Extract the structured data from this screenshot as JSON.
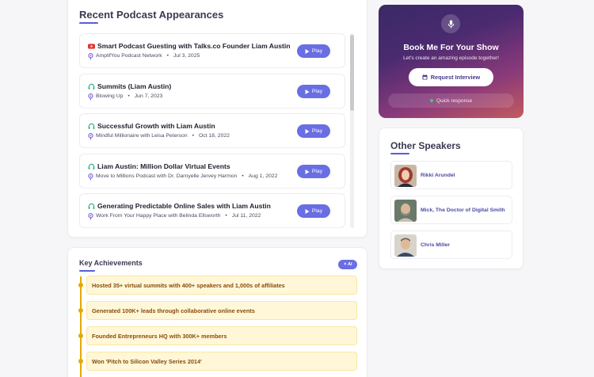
{
  "podcasts": {
    "title": "Recent Podcast Appearances",
    "play_label": "Play",
    "items": [
      {
        "title": "Smart Podcast Guesting with Talks.co Founder Liam Austin",
        "network": "AmplifYou Podcast Network",
        "date": "Jul 3, 2025",
        "icon": "youtube-icon"
      },
      {
        "title": "Summits (Liam Austin)",
        "network": "Blowing Up",
        "date": "Jun 7, 2023",
        "icon": "headphones-icon"
      },
      {
        "title": "Successful Growth with Liam Austin",
        "network": "Mindful Millionaire with Leisa Peterson",
        "date": "Oct 18, 2022",
        "icon": "headphones-icon"
      },
      {
        "title": "Liam Austin: Million Dollar Virtual Events",
        "network": "Move to Millions Podcast with Dr. Darnyelle Jervey Harmon",
        "date": "Aug 1, 2022",
        "icon": "headphones-icon"
      },
      {
        "title": "Generating Predictable Online Sales with Liam Austin",
        "network": "Work From Your Happy Place with Belinda Ellsworth",
        "date": "Jul 11, 2022",
        "icon": "headphones-icon"
      }
    ]
  },
  "achievements": {
    "title": "Key Achievements",
    "ai_badge": "AI",
    "items": [
      "Hosted 35+ virtual summits with 400+ speakers and 1,000s of affiliates",
      "Generated 100K+ leads through collaborative online events",
      "Founded Entrepreneurs HQ with 300K+ members",
      "Won 'Pitch to Silicon Valley Series 2014'"
    ]
  },
  "booking": {
    "title": "Book Me For Your Show",
    "subtitle": "Let's create an amazing episode together!",
    "cta": "Request Interview",
    "quick": "Quick response"
  },
  "speakers": {
    "title": "Other Speakers",
    "items": [
      {
        "name": "Rikki Arundel"
      },
      {
        "name": "Mick, The Doctor of Digital Smith"
      },
      {
        "name": "Chris Miller"
      }
    ]
  },
  "colors": {
    "accent": "#6a6ee3",
    "achievement_bg": "#fff7d8",
    "achievement_text": "#8a4b0d",
    "timeline": "#e6a800"
  }
}
